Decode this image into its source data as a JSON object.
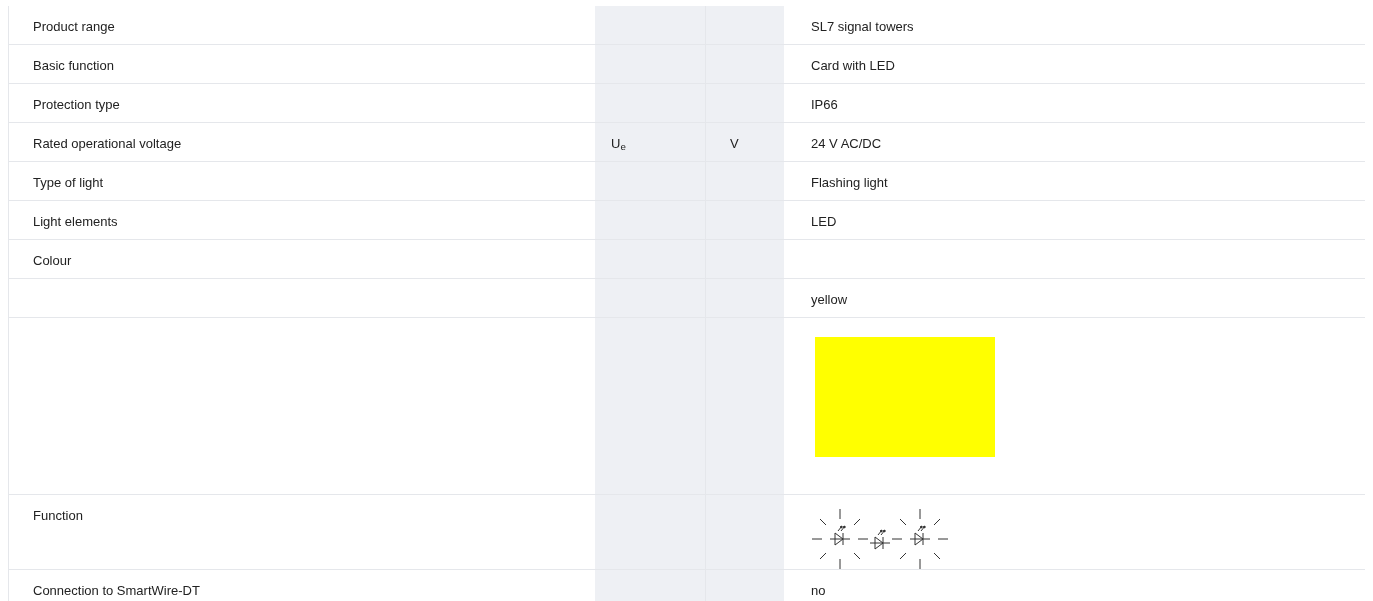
{
  "rows": [
    {
      "kind": "text",
      "label": "Product range",
      "value": "SL7 signal towers"
    },
    {
      "kind": "text",
      "label": "Basic function",
      "value": "Card with LED"
    },
    {
      "kind": "text",
      "label": "Protection type",
      "value": "IP66"
    },
    {
      "kind": "text",
      "label": "Rated operational voltage",
      "symbol": "U$_{e}$",
      "unit": "V",
      "value": "24 V AC/DC"
    },
    {
      "kind": "text",
      "label": "Type of light",
      "value": "Flashing light"
    },
    {
      "kind": "text",
      "label": "Light elements",
      "value": "LED"
    },
    {
      "kind": "text",
      "label": "Colour"
    },
    {
      "kind": "text",
      "value": "yellow"
    },
    {
      "kind": "swatch",
      "color": "#ffff00"
    },
    {
      "kind": "function",
      "label": "Function",
      "leds": [
        {
          "flashing": true
        },
        {
          "flashing": false
        },
        {
          "flashing": true
        }
      ]
    },
    {
      "kind": "text",
      "label": "Connection to SmartWire-DT",
      "value": "no"
    }
  ]
}
